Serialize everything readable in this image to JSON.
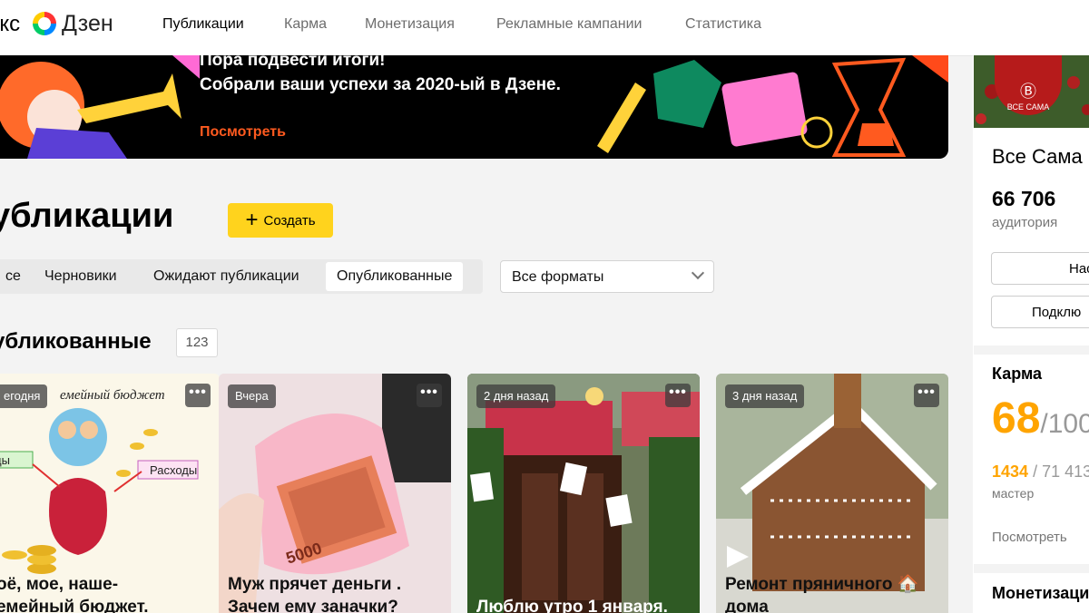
{
  "header": {
    "logo_prefix": "екс",
    "logo_brand": "Дзен",
    "nav": [
      {
        "label": "Публикации",
        "active": true
      },
      {
        "label": "Карма",
        "active": false
      },
      {
        "label": "Монетизация",
        "active": false
      },
      {
        "label": "Рекламные кампании",
        "active": false
      },
      {
        "label": "Статистика",
        "active": false
      }
    ]
  },
  "banner": {
    "title_line1": "Пора подвести итоги!",
    "title_line2": "Собрали ваши успехи за 2020-ый в Дзене.",
    "link": "Посмотреть",
    "link_color": "#ff5a1f"
  },
  "main": {
    "title": "убликации",
    "create_label": "Создать",
    "tabs": [
      {
        "label": "се",
        "active": false
      },
      {
        "label": "Черновики",
        "active": false
      },
      {
        "label": "Ожидают публикации",
        "active": false
      },
      {
        "label": "Опубликованные",
        "active": true
      }
    ],
    "format_select": "Все форматы",
    "section_title": "убликованные",
    "section_count": "123",
    "more_icon": "ellipsis-icon",
    "cards": [
      {
        "badge": "егодня",
        "image_label_1": "емейный бюджет",
        "image_label_2": "Расходы",
        "image_label_3": "ды",
        "title": "оё, мое, наше-\nемейный бюджет."
      },
      {
        "badge": "Вчера",
        "image_label_1": "5000",
        "title": "Муж прячет деньги .\nЗачем ему заначки?"
      },
      {
        "badge": "2 дня назад",
        "title": "Люблю утро 1 января."
      },
      {
        "badge": "3 дня назад",
        "title": "Ремонт пряничного 🏠\nдома"
      }
    ]
  },
  "sidebar": {
    "avatar_text": "ВСЕ САМА",
    "channel_name": "Все Сама",
    "audience_value": "66 706",
    "audience_label": "аудитория",
    "button1": "Нас",
    "button2": "Подклю",
    "karma_title": "Карма",
    "karma_value": "68",
    "karma_max": "/100",
    "karma_rank": "1434",
    "karma_rank_total": "/ 71 413",
    "karma_level": "мастер",
    "karma_link": "Посмотреть",
    "monetization_title": "Монетизация",
    "accent_color": "#ffa400"
  }
}
